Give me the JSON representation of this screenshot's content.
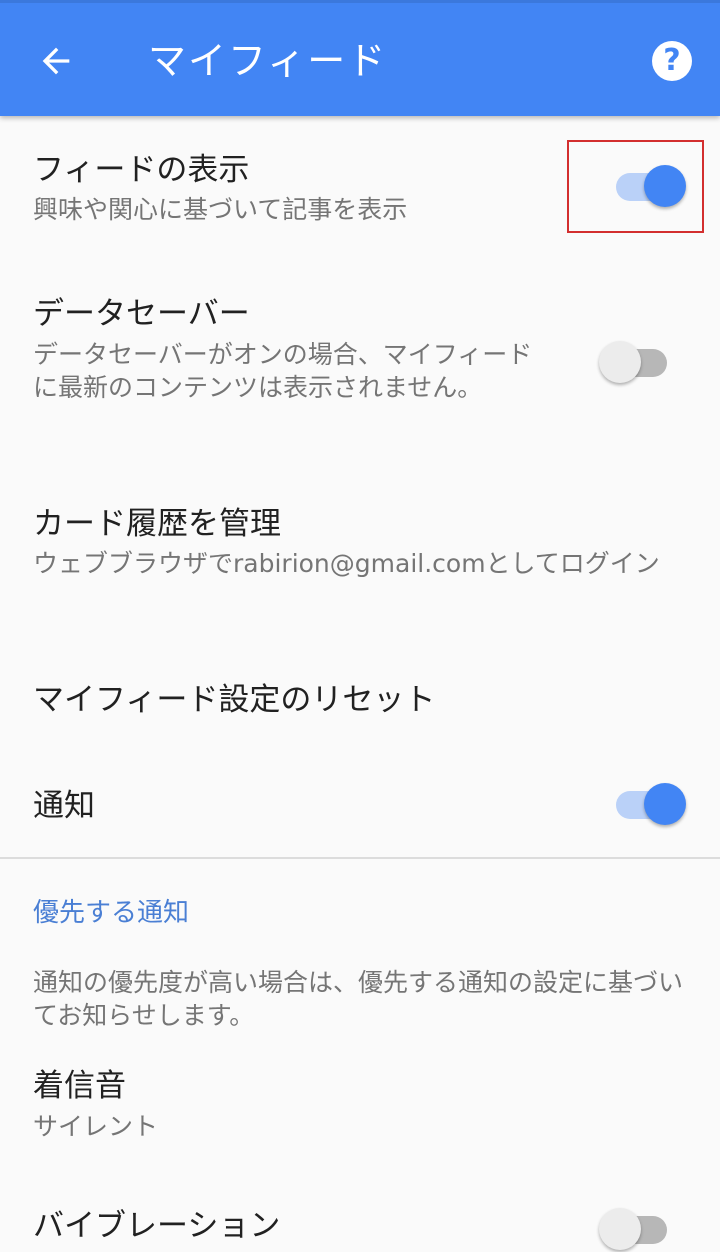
{
  "appbar": {
    "title": "マイフィード",
    "back_icon": "arrow-back-icon",
    "help_icon": "help-circle-icon",
    "help_glyph": "?",
    "color": "#4285f4"
  },
  "prefs": {
    "feed": {
      "title": "フィードの表示",
      "summary": "興味や関心に基づいて記事を表示",
      "enabled": true
    },
    "data_saver": {
      "title": "データセーバー",
      "summary": "データセーバーがオンの場合、マイフィードに最新のコンテンツは表示されません。",
      "enabled": false
    },
    "card_history": {
      "title": "カード履歴を管理",
      "summary": "ウェブブラウザでrabirion@gmail.comとしてログイン"
    },
    "reset": {
      "title": "マイフィード設定のリセット"
    },
    "notifications": {
      "title": "通知",
      "enabled": true
    },
    "priority_category": {
      "title": "優先する通知"
    },
    "priority_note": {
      "summary": "通知の優先度が高い場合は、優先する通知の設定に基づいてお知らせします。"
    },
    "ringtone": {
      "title": "着信音",
      "summary": "サイレント"
    },
    "vibration": {
      "title": "バイブレーション",
      "enabled": false
    }
  },
  "colors": {
    "accent": "#4285f4",
    "highlight": "#d32f2f",
    "category": "#4a7fd4"
  }
}
